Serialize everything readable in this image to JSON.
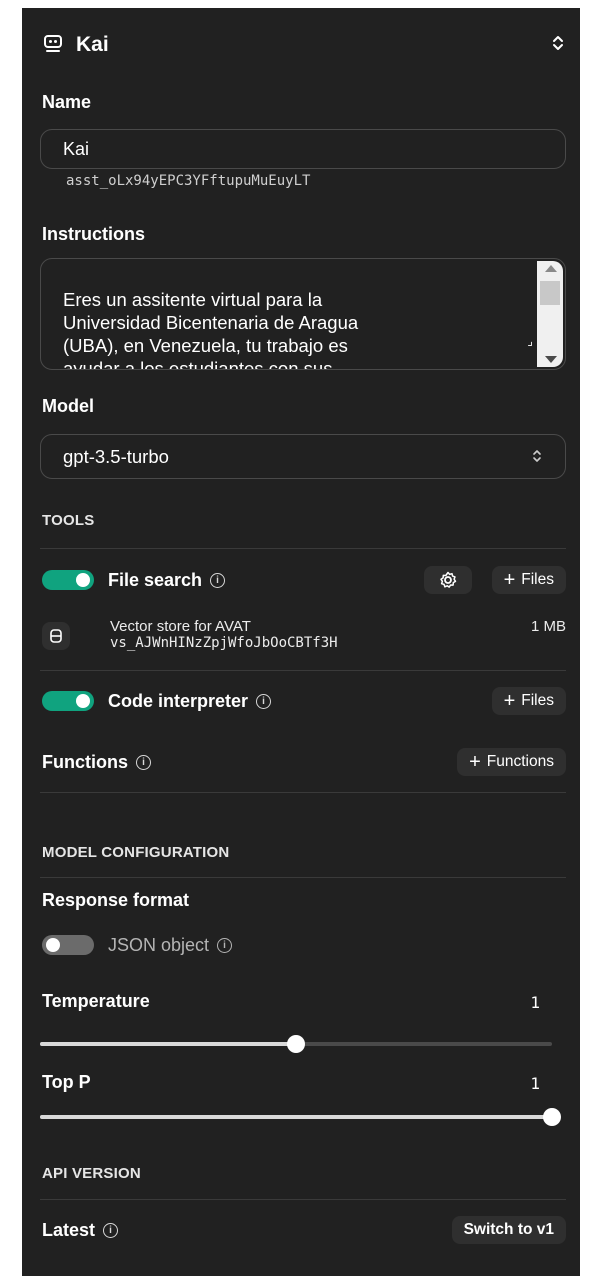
{
  "header": {
    "title": "Kai"
  },
  "name": {
    "label": "Name",
    "value": "Kai",
    "assistant_id": "asst_oLx94yEPC3YFftupuMuEuyLT"
  },
  "instructions": {
    "label": "Instructions",
    "value": "Eres un assitente virtual para la\nUniversidad Bicentenaria de Aragua\n(UBA), en Venezuela, tu trabajo es\nayudar a los estudiantes con sus\ndudas sobre diferentes actividades"
  },
  "model": {
    "label": "Model",
    "value": "gpt-3.5-turbo"
  },
  "tools": {
    "section_label": "TOOLS",
    "file_search": {
      "label": "File search",
      "enabled": true,
      "files_button": "Files"
    },
    "vector_store": {
      "name": "Vector store for AVAT",
      "id": "vs_AJWnHINzZpjWfoJbOoCBTf3H",
      "size": "1 MB"
    },
    "code_interpreter": {
      "label": "Code interpreter",
      "enabled": true,
      "files_button": "Files"
    },
    "functions": {
      "label": "Functions",
      "button": "Functions"
    }
  },
  "model_config": {
    "section_label": "MODEL CONFIGURATION",
    "response_format": {
      "label": "Response format",
      "json_object_label": "JSON object",
      "enabled": false
    },
    "temperature": {
      "label": "Temperature",
      "value": "1",
      "fraction": 0.5
    },
    "top_p": {
      "label": "Top P",
      "value": "1",
      "fraction": 1.0
    }
  },
  "api_version": {
    "section_label": "API VERSION",
    "label": "Latest",
    "button": "Switch to v1"
  },
  "colors": {
    "panel_bg": "#212121",
    "toggle_on": "#10a37f",
    "button_bg": "#2f2f2f"
  }
}
